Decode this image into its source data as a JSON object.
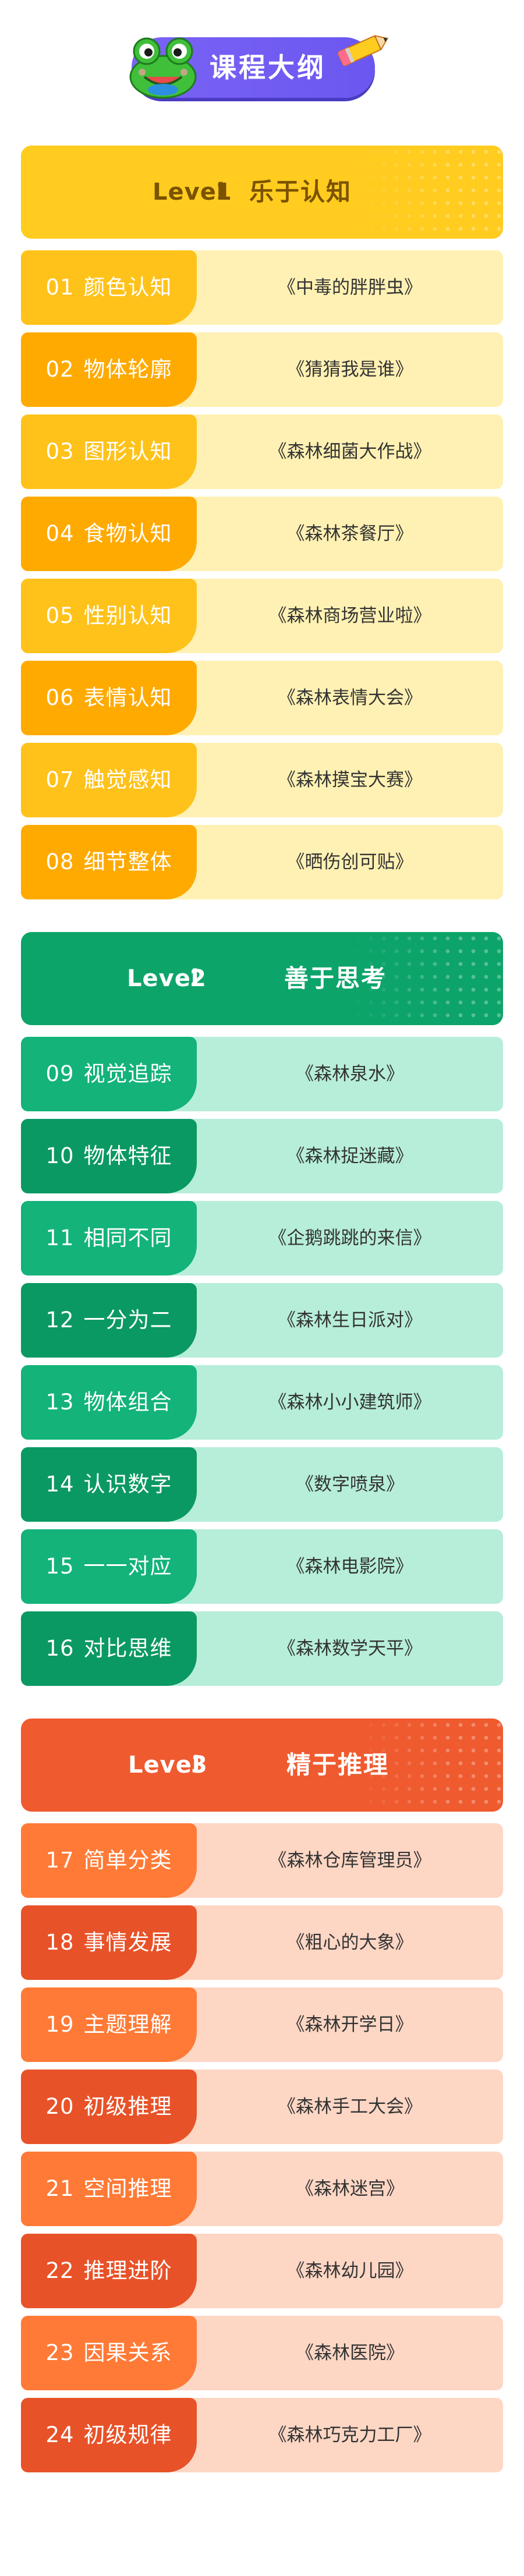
{
  "header": {
    "title": "课程大纲",
    "frog_icon": "frog-mascot-icon",
    "pencil_icon": "pencil-icon"
  },
  "colors": {
    "level1": {
      "banner": "#ffcc1f",
      "banner_text": "#7a5200",
      "chip_a": "#ffc21a",
      "chip_b": "#ffaa00",
      "row_bg": "#fff1b3"
    },
    "level2": {
      "banner": "#0da46a",
      "banner_text": "#ffffff",
      "chip_a": "#13b37a",
      "chip_b": "#0b9963",
      "row_bg": "#b6eed9"
    },
    "level3": {
      "banner": "#ef5a2f",
      "banner_text": "#ffffff",
      "chip_a": "#ff7a36",
      "chip_b": "#e85228",
      "row_bg": "#fdd6c4"
    },
    "title_pill": "#7060f2"
  },
  "levels": [
    {
      "word": "Level",
      "num": "1",
      "name": "乐于认知",
      "lessons": [
        {
          "num": "01",
          "topic": "颜色认知",
          "book": "《中毒的胖胖虫》"
        },
        {
          "num": "02",
          "topic": "物体轮廓",
          "book": "《猜猜我是谁》"
        },
        {
          "num": "03",
          "topic": "图形认知",
          "book": "《森林细菌大作战》"
        },
        {
          "num": "04",
          "topic": "食物认知",
          "book": "《森林茶餐厅》"
        },
        {
          "num": "05",
          "topic": "性别认知",
          "book": "《森林商场营业啦》"
        },
        {
          "num": "06",
          "topic": "表情认知",
          "book": "《森林表情大会》"
        },
        {
          "num": "07",
          "topic": "触觉感知",
          "book": "《森林摸宝大赛》"
        },
        {
          "num": "08",
          "topic": "细节整体",
          "book": "《晒伤创可贴》"
        }
      ]
    },
    {
      "word": "Level",
      "num": "2",
      "name": "善于思考",
      "lessons": [
        {
          "num": "09",
          "topic": "视觉追踪",
          "book": "《森林泉水》"
        },
        {
          "num": "10",
          "topic": "物体特征",
          "book": "《森林捉迷藏》"
        },
        {
          "num": "11",
          "topic": "相同不同",
          "book": "《企鹅跳跳的来信》"
        },
        {
          "num": "12",
          "topic": "一分为二",
          "book": "《森林生日派对》"
        },
        {
          "num": "13",
          "topic": "物体组合",
          "book": "《森林小小建筑师》"
        },
        {
          "num": "14",
          "topic": "认识数字",
          "book": "《数字喷泉》"
        },
        {
          "num": "15",
          "topic": "一一对应",
          "book": "《森林电影院》"
        },
        {
          "num": "16",
          "topic": "对比思维",
          "book": "《森林数学天平》"
        }
      ]
    },
    {
      "word": "Level",
      "num": "3",
      "name": "精于推理",
      "lessons": [
        {
          "num": "17",
          "topic": "简单分类",
          "book": "《森林仓库管理员》"
        },
        {
          "num": "18",
          "topic": "事情发展",
          "book": "《粗心的大象》"
        },
        {
          "num": "19",
          "topic": "主题理解",
          "book": "《森林开学日》"
        },
        {
          "num": "20",
          "topic": "初级推理",
          "book": "《森林手工大会》"
        },
        {
          "num": "21",
          "topic": "空间推理",
          "book": "《森林迷宫》"
        },
        {
          "num": "22",
          "topic": "推理进阶",
          "book": "《森林幼儿园》"
        },
        {
          "num": "23",
          "topic": "因果关系",
          "book": "《森林医院》"
        },
        {
          "num": "24",
          "topic": "初级规律",
          "book": "《森林巧克力工厂》"
        }
      ]
    }
  ]
}
